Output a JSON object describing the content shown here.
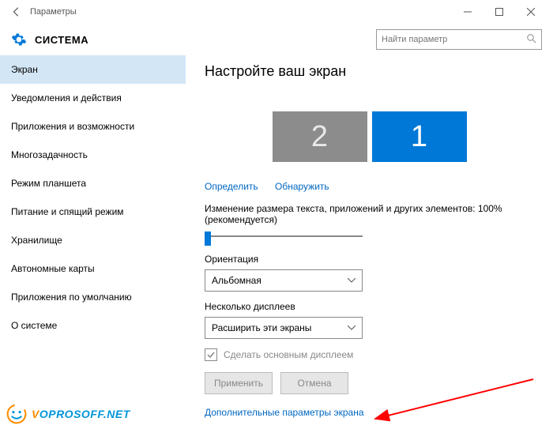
{
  "titlebar": {
    "title": "Параметры"
  },
  "header": {
    "title": "СИСТЕМА",
    "search_placeholder": "Найти параметр"
  },
  "sidebar": {
    "items": [
      "Экран",
      "Уведомления и действия",
      "Приложения и возможности",
      "Многозадачность",
      "Режим планшета",
      "Питание и спящий режим",
      "Хранилище",
      "Автономные карты",
      "Приложения по умолчанию",
      "О системе"
    ],
    "active_index": 0
  },
  "main": {
    "heading": "Настройте ваш экран",
    "monitors": {
      "secondary": "2",
      "primary": "1"
    },
    "identify": "Определить",
    "detect": "Обнаружить",
    "scaling_label": "Изменение размера текста, приложений и других элементов: 100% (рекомендуется)",
    "orientation_label": "Ориентация",
    "orientation_value": "Альбомная",
    "multi_label": "Несколько дисплеев",
    "multi_value": "Расширить эти экраны",
    "make_main": "Сделать основным дисплеем",
    "apply": "Применить",
    "cancel": "Отмена",
    "advanced": "Дополнительные параметры экрана"
  },
  "watermark": {
    "v": "V",
    "rest": "OPROSOFF.NET"
  }
}
